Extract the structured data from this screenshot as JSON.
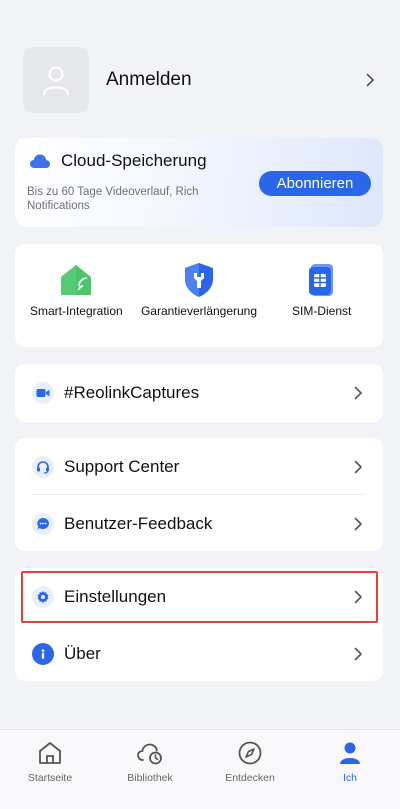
{
  "profile": {
    "name": "Anmelden",
    "avatar_icon": "user-icon"
  },
  "cloud": {
    "title": "Cloud-Speicherung",
    "description": "Bis zu 60 Tage Videoverlauf, Rich Notifications",
    "subscribe_label": "Abonnieren"
  },
  "services": [
    {
      "label": "Smart-Integration",
      "icon": "smart-home-icon"
    },
    {
      "label": "Garantieverlängerung",
      "icon": "warranty-shield-icon"
    },
    {
      "label": "SIM-Dienst",
      "icon": "sim-card-icon"
    }
  ],
  "menu": {
    "captures": "#ReolinkCaptures",
    "support": "Support Center",
    "feedback": "Benutzer-Feedback",
    "settings": "Einstellungen",
    "about": "Über"
  },
  "tabs": [
    {
      "label": "Startseite",
      "icon": "home-icon"
    },
    {
      "label": "Bibliothek",
      "icon": "cloud-library-icon"
    },
    {
      "label": "Entdecken",
      "icon": "compass-icon"
    },
    {
      "label": "Ich",
      "icon": "person-icon",
      "active": true
    }
  ],
  "colors": {
    "accent": "#2a66e8",
    "highlight": "#e0433b",
    "background": "#f2f3f7"
  }
}
